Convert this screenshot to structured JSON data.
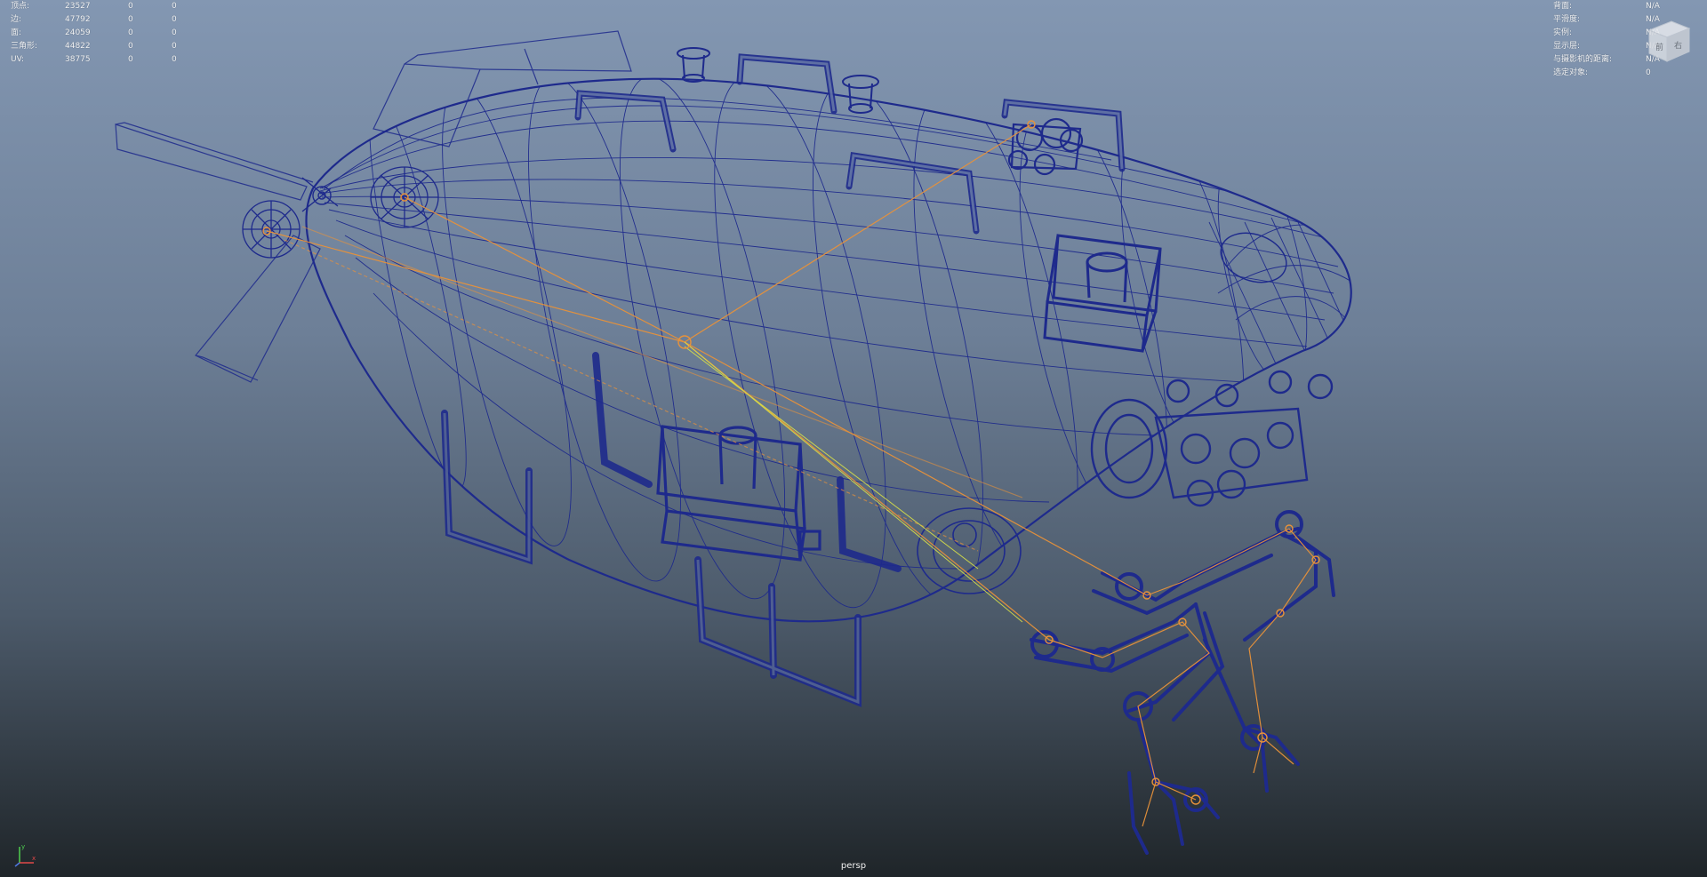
{
  "hud_stats": {
    "rows": [
      {
        "label": "顶点:",
        "v1": "23527",
        "v2": "0",
        "v3": "0"
      },
      {
        "label": "边:",
        "v1": "47792",
        "v2": "0",
        "v3": "0"
      },
      {
        "label": "面:",
        "v1": "24059",
        "v2": "0",
        "v3": "0"
      },
      {
        "label": "三角形:",
        "v1": "44822",
        "v2": "0",
        "v3": "0"
      },
      {
        "label": "UV:",
        "v1": "38775",
        "v2": "0",
        "v3": "0"
      }
    ]
  },
  "hud_info": {
    "rows": [
      {
        "label": "背面:",
        "value": "N/A"
      },
      {
        "label": "平滑度:",
        "value": "N/A"
      },
      {
        "label": "实例:",
        "value": "N/A"
      },
      {
        "label": "显示层:",
        "value": "N/A"
      },
      {
        "label": "与摄影机的距离:",
        "value": "N/A"
      },
      {
        "label": "选定对象:",
        "value": "0"
      }
    ]
  },
  "viewport": {
    "camera_name": "persp",
    "wire_color": "#1e2a8c",
    "joint_color": "#e8923a",
    "ik_color": "#d8e048",
    "background_top": "#8397b2",
    "background_bottom": "#1f2529"
  },
  "view_cube": {
    "front_label": "前",
    "right_label": "右"
  },
  "axis_gizmo": {
    "x_label": "x",
    "y_label": "y"
  }
}
